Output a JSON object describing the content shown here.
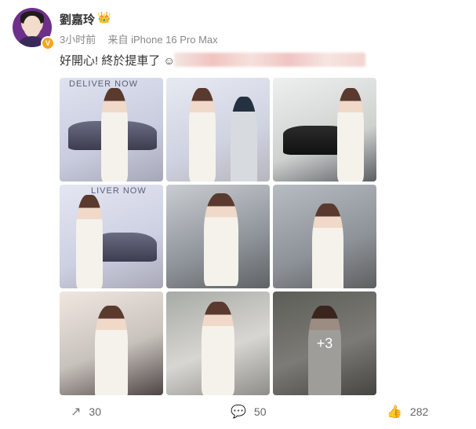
{
  "post": {
    "author": "劉嘉玲",
    "meta": {
      "time": "3小时前",
      "source": "来自 iPhone 16 Pro Max"
    },
    "text": "好開心! 終於提車了",
    "images": [
      {
        "sign": "DELIVER NOW"
      },
      {
        "sign": ""
      },
      {
        "sign": ""
      },
      {
        "sign": "LIVER NOW"
      },
      {
        "sign": ""
      },
      {
        "sign": ""
      },
      {
        "sign": ""
      },
      {
        "sign": ""
      },
      {
        "sign": "",
        "more": "+3"
      }
    ],
    "actions": {
      "share": "30",
      "comment": "50",
      "like": "282"
    }
  },
  "icons": {
    "verified": "verified-badge-icon",
    "crown": "crown-icon",
    "smile": "smile-emoji-icon",
    "share": "share-icon",
    "comment": "comment-icon",
    "like": "like-icon"
  }
}
